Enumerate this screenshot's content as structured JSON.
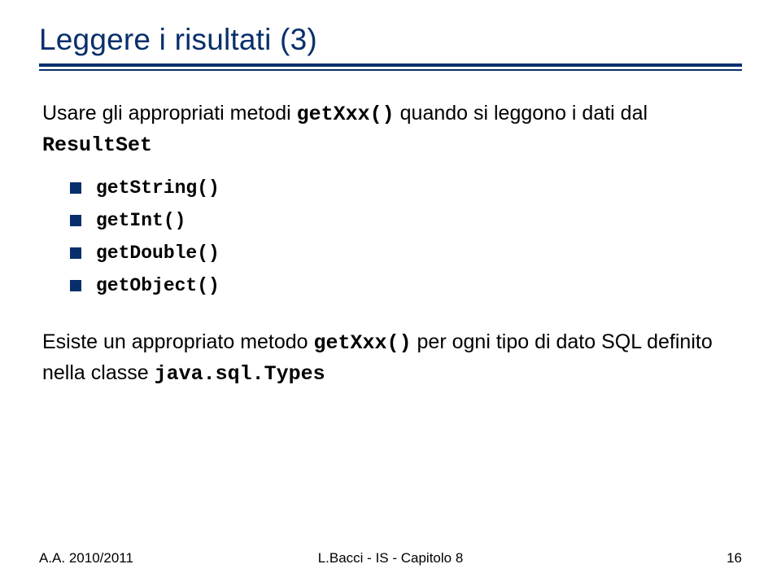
{
  "title": "Leggere i risultati (3)",
  "para1": {
    "t1": "Usare gli appropriati metodi ",
    "m1": "getXxx()",
    "t2": " quando si leggono i dati dal ",
    "m2": "ResultSet"
  },
  "bullets": [
    "getString()",
    "getInt()",
    "getDouble()",
    "getObject()"
  ],
  "para2": {
    "t1": "Esiste un appropriato metodo ",
    "m1": "getXxx()",
    "t2": " per ogni tipo di dato SQL definito nella classe ",
    "m2": "java.sql.Types"
  },
  "footer": {
    "left": "A.A. 2010/2011",
    "center": "L.Bacci - IS - Capitolo 8",
    "right": "16"
  }
}
